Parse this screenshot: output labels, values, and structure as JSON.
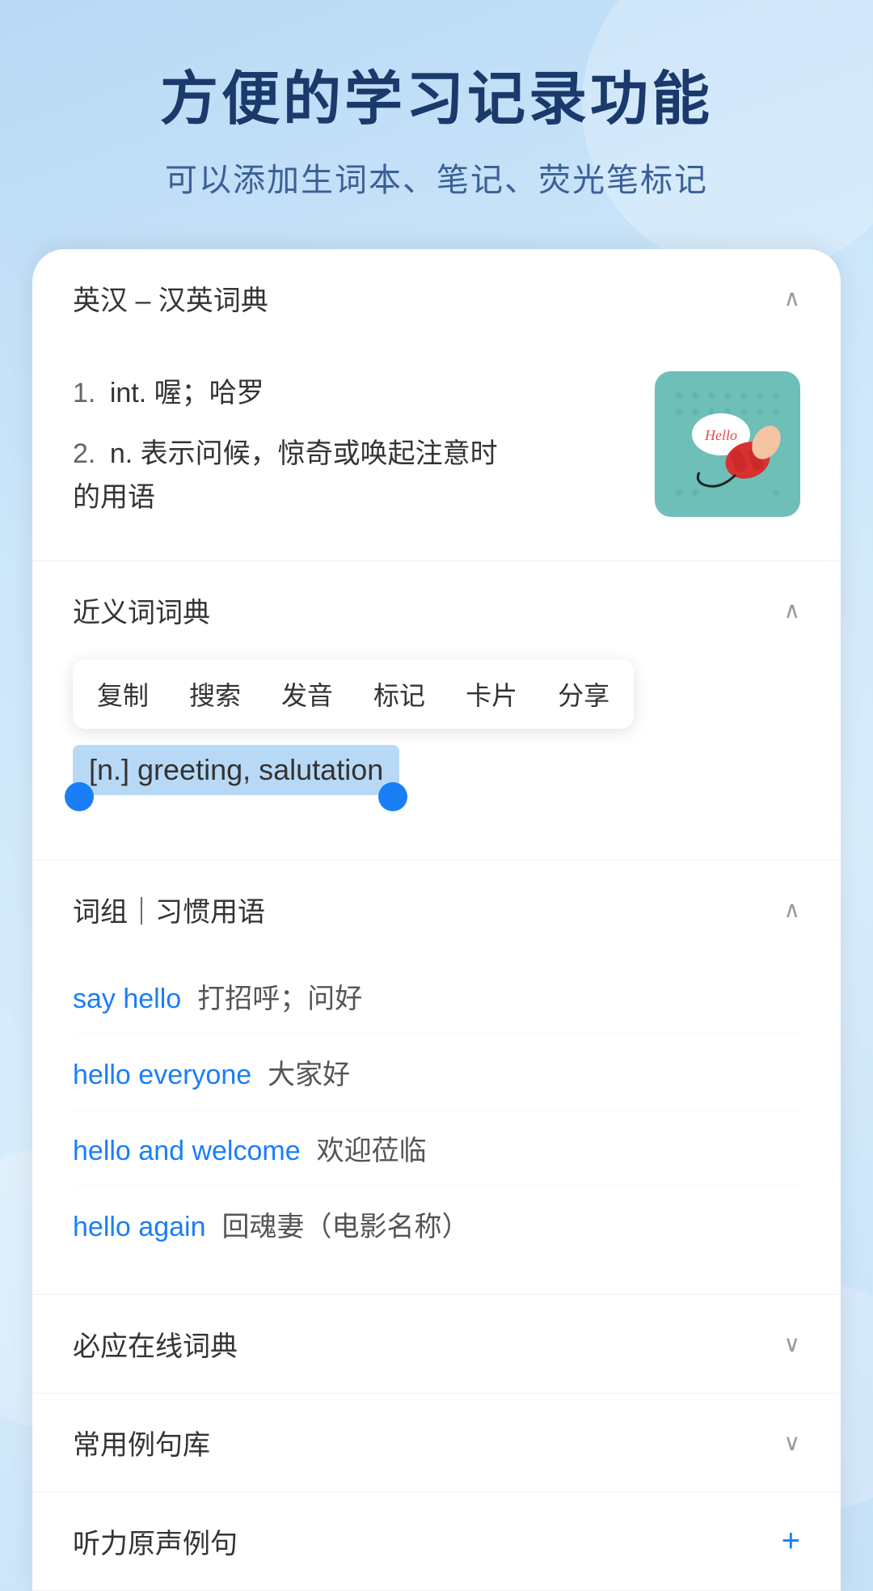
{
  "header": {
    "title": "方便的学习记录功能",
    "subtitle": "可以添加生词本、笔记、荧光笔标记"
  },
  "dict_section": {
    "title": "英汉 – 汉英词典",
    "definitions": [
      {
        "number": "1.",
        "pos": "int.",
        "meaning": "喔；哈罗"
      },
      {
        "number": "2.",
        "pos": "n.",
        "meaning": "表示问候，惊奇或唤起注意时的用语"
      }
    ]
  },
  "synonym_section": {
    "title": "近义词词典",
    "context_menu": {
      "items": [
        "复制",
        "搜索",
        "发音",
        "标记",
        "卡片",
        "分享"
      ]
    },
    "highlighted": "[n.] greeting, salutation"
  },
  "phrases_section": {
    "title": "词组｜习惯用语",
    "items": [
      {
        "en": "say hello",
        "zh": "打招呼；问好"
      },
      {
        "en": "hello everyone",
        "zh": "大家好"
      },
      {
        "en": "hello and welcome",
        "zh": "欢迎莅临"
      },
      {
        "en": "hello again",
        "zh": "回魂妻（电影名称）"
      }
    ]
  },
  "collapsed_sections": [
    {
      "id": "biying",
      "title": "必应在线词典",
      "expanded": false,
      "has_plus": false
    },
    {
      "id": "common_sentences",
      "title": "常用例句库",
      "expanded": false,
      "has_plus": false
    },
    {
      "id": "listening",
      "title": "听力原声例句",
      "expanded": false,
      "has_plus": true
    }
  ],
  "icons": {
    "chevron_up": "∧",
    "chevron_down": "∨",
    "plus": "+"
  }
}
